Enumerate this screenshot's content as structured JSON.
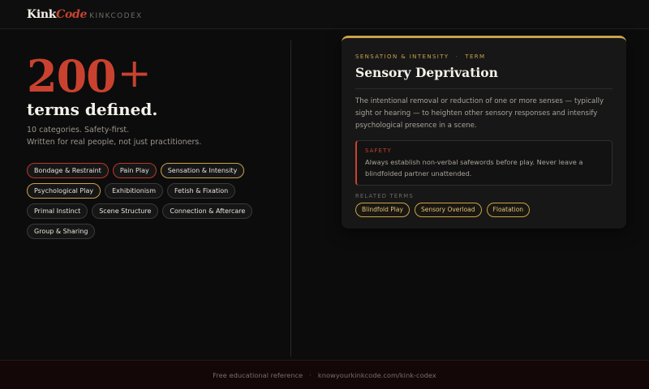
{
  "header": {
    "logo_kink": "Kink",
    "logo_code": "Code",
    "logo_sub": "KINKCODEX"
  },
  "hero": {
    "number": "200",
    "plus": "+",
    "subhead": "terms defined.",
    "tagline_1": "10 categories. Safety-first.",
    "tagline_2": "Written for real people, not just practitioners."
  },
  "categories": [
    {
      "label": "Bondage & Restraint",
      "accent": "red"
    },
    {
      "label": "Pain Play",
      "accent": "red"
    },
    {
      "label": "Sensation & Intensity",
      "accent": "gold"
    },
    {
      "label": "Psychological Play",
      "accent": "gold"
    },
    {
      "label": "Exhibitionism",
      "accent": "none"
    },
    {
      "label": "Fetish & Fixation",
      "accent": "none"
    },
    {
      "label": "Primal Instinct",
      "accent": "none"
    },
    {
      "label": "Scene Structure",
      "accent": "none"
    },
    {
      "label": "Connection & Aftercare",
      "accent": "none"
    },
    {
      "label": "Group & Sharing",
      "accent": "none"
    }
  ],
  "card": {
    "category": "SENSATION & INTENSITY",
    "dot": "·",
    "kind": "TERM",
    "title": "Sensory Deprivation",
    "description": "The intentional removal or reduction of one or more senses — typically sight or hearing — to heighten other sensory responses and intensify psychological presence in a scene.",
    "safety_label": "SAFETY",
    "safety_text": "Always establish non-verbal safewords before play. Never leave a blindfolded partner unattended.",
    "related_label": "RELATED TERMS",
    "related": [
      "Blindfold Play",
      "Sensory Overload",
      "Floatation"
    ]
  },
  "footer": {
    "text": "Free educational reference",
    "sep": "·",
    "url": "knowyourkinkcode.com/kink-codex"
  },
  "colors": {
    "accent_red": "#c9422f",
    "accent_gold": "#c9a24a",
    "background": "#0c0c0c"
  }
}
